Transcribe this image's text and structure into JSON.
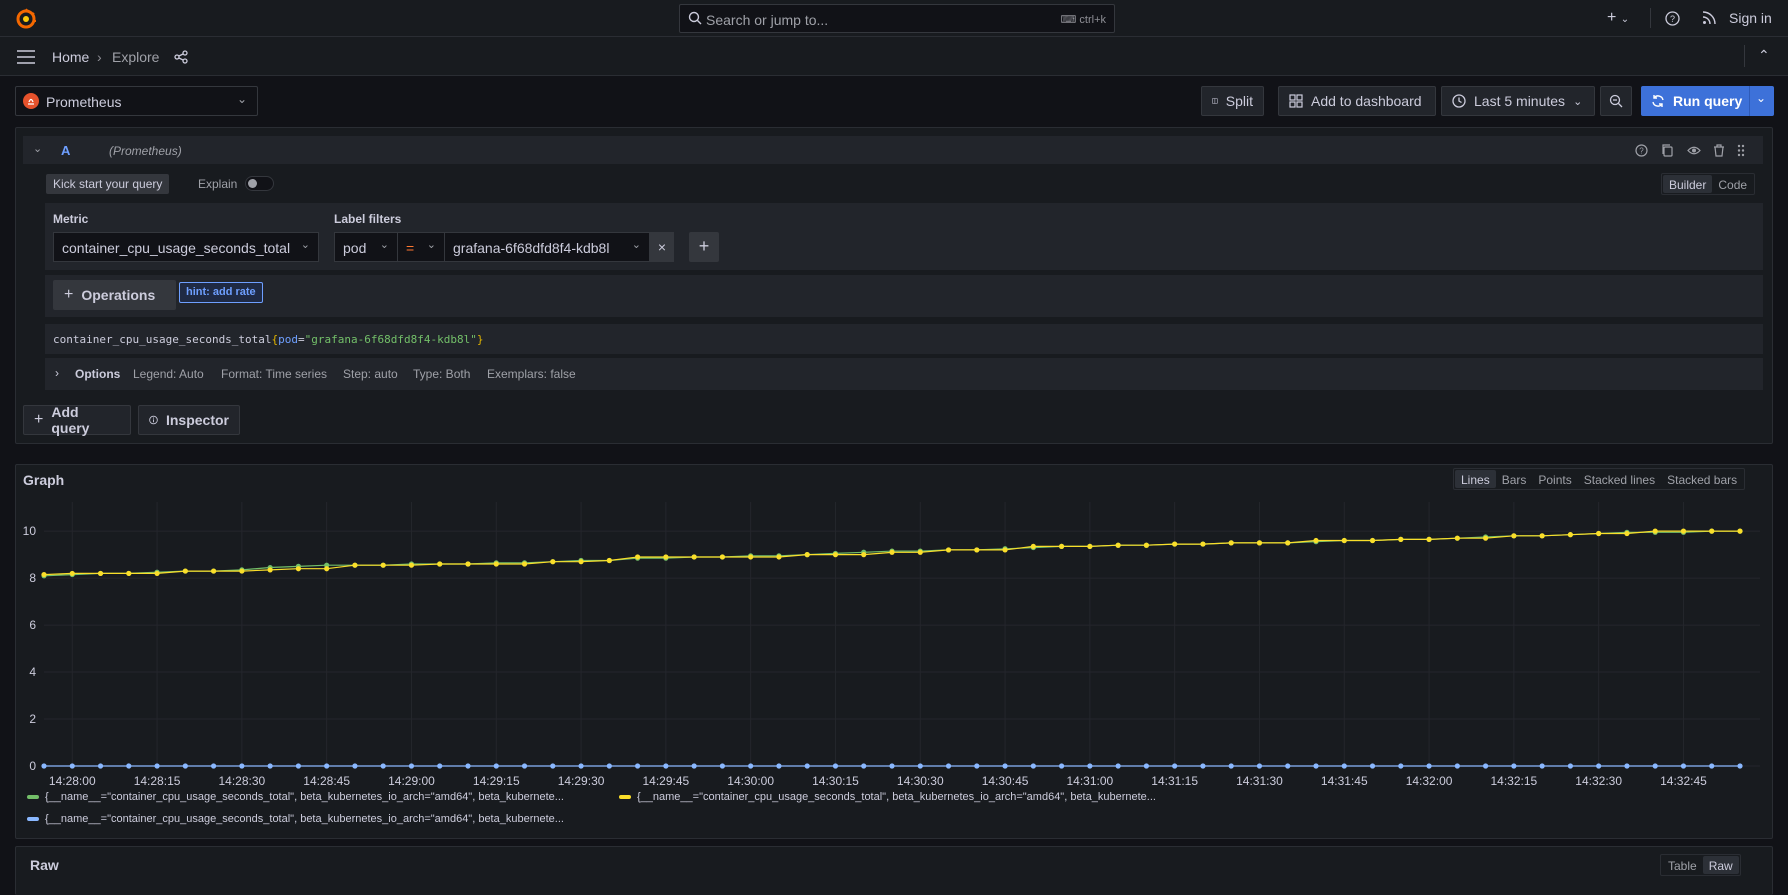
{
  "topbar": {
    "search_placeholder": "Search or jump to...",
    "search_shortcut": "ctrl+k",
    "sign_in": "Sign in"
  },
  "breadcrumb": {
    "home": "Home",
    "current": "Explore"
  },
  "toolbar": {
    "datasource": "Prometheus",
    "split": "Split",
    "add_to_dashboard": "Add to dashboard",
    "time_range": "Last 5 minutes",
    "run_query": "Run query"
  },
  "query": {
    "ref_id": "A",
    "datasource_label": "(Prometheus)",
    "kick_start": "Kick start your query",
    "explain": "Explain",
    "mode_builder": "Builder",
    "mode_code": "Code",
    "metric_label": "Metric",
    "metric_value": "container_cpu_usage_seconds_total",
    "label_filters_label": "Label filters",
    "label_key": "pod",
    "label_op": "=",
    "label_value": "grafana-6f68dfd8f4-kdb8l",
    "operations": "Operations",
    "hint": "hint: add rate",
    "preview_metric": "container_cpu_usage_seconds_total",
    "preview_open": "{",
    "preview_key": "pod",
    "preview_eq": "=",
    "preview_val": "\"grafana-6f68dfd8f4-kdb8l\"",
    "preview_close": "}",
    "options_title": "Options",
    "options_legend": "Legend: Auto",
    "options_format": "Format: Time series",
    "options_step": "Step: auto",
    "options_type": "Type: Both",
    "options_exemplars": "Exemplars: false"
  },
  "actions": {
    "add_query": "Add query",
    "inspector": "Inspector"
  },
  "graph": {
    "title": "Graph",
    "modes": [
      "Lines",
      "Bars",
      "Points",
      "Stacked lines",
      "Stacked bars"
    ],
    "active_mode": "Lines",
    "legend": [
      {
        "text": "{__name__=\"container_cpu_usage_seconds_total\", beta_kubernetes_io_arch=\"amd64\", beta_kubernete...",
        "color": "#73bf69"
      },
      {
        "text": "{__name__=\"container_cpu_usage_seconds_total\", beta_kubernetes_io_arch=\"amd64\", beta_kubernete...",
        "color": "#fade2a"
      },
      {
        "text": "{__name__=\"container_cpu_usage_seconds_total\", beta_kubernetes_io_arch=\"amd64\", beta_kubernete...",
        "color": "#8ab8ff"
      }
    ]
  },
  "raw": {
    "title": "Raw",
    "modes": [
      "Table",
      "Raw"
    ],
    "active_mode": "Raw"
  },
  "chart_data": {
    "type": "line",
    "x_ticks": [
      "14:28:00",
      "14:28:15",
      "14:28:30",
      "14:28:45",
      "14:29:00",
      "14:29:15",
      "14:29:30",
      "14:29:45",
      "14:30:00",
      "14:30:15",
      "14:30:30",
      "14:30:45",
      "14:31:00",
      "14:31:15",
      "14:31:30",
      "14:31:45",
      "14:32:00",
      "14:32:15",
      "14:32:30",
      "14:32:45"
    ],
    "y_ticks": [
      0,
      2,
      4,
      6,
      8,
      10
    ],
    "ylim": [
      0,
      10.9
    ],
    "x_start": "14:27:55",
    "x_step_seconds": 5,
    "grid": true,
    "legend_position": "bottom",
    "series": [
      {
        "color": "#73bf69",
        "values": [
          8.1,
          8.15,
          8.2,
          8.2,
          8.25,
          8.3,
          8.3,
          8.35,
          8.45,
          8.5,
          8.55,
          8.55,
          8.55,
          8.6,
          8.6,
          8.6,
          8.65,
          8.65,
          8.7,
          8.75,
          8.75,
          8.85,
          8.85,
          8.9,
          8.9,
          8.95,
          8.95,
          9.0,
          9.05,
          9.1,
          9.15,
          9.15,
          9.2,
          9.2,
          9.25,
          9.3,
          9.35,
          9.35,
          9.4,
          9.4,
          9.45,
          9.45,
          9.5,
          9.5,
          9.5,
          9.55,
          9.6,
          9.6,
          9.65,
          9.65,
          9.7,
          9.75,
          9.8,
          9.8,
          9.85,
          9.9,
          9.95,
          9.95,
          9.95,
          10.0,
          10.0
        ]
      },
      {
        "color": "#fade2a",
        "values": [
          8.15,
          8.2,
          8.2,
          8.2,
          8.2,
          8.3,
          8.3,
          8.3,
          8.35,
          8.4,
          8.4,
          8.55,
          8.55,
          8.55,
          8.6,
          8.6,
          8.6,
          8.6,
          8.7,
          8.7,
          8.75,
          8.9,
          8.9,
          8.9,
          8.9,
          8.9,
          8.9,
          9.0,
          9.0,
          9.0,
          9.1,
          9.1,
          9.2,
          9.2,
          9.2,
          9.35,
          9.35,
          9.35,
          9.4,
          9.4,
          9.45,
          9.45,
          9.5,
          9.5,
          9.5,
          9.6,
          9.6,
          9.6,
          9.65,
          9.65,
          9.7,
          9.7,
          9.8,
          9.8,
          9.85,
          9.9,
          9.9,
          10.0,
          10.0,
          10.0,
          10.0
        ]
      },
      {
        "color": "#8ab8ff",
        "values": [
          0,
          0,
          0,
          0,
          0,
          0,
          0,
          0,
          0,
          0,
          0,
          0,
          0,
          0,
          0,
          0,
          0,
          0,
          0,
          0,
          0,
          0,
          0,
          0,
          0,
          0,
          0,
          0,
          0,
          0,
          0,
          0,
          0,
          0,
          0,
          0,
          0,
          0,
          0,
          0,
          0,
          0,
          0,
          0,
          0,
          0,
          0,
          0,
          0,
          0,
          0,
          0,
          0,
          0,
          0,
          0,
          0,
          0,
          0,
          0,
          0
        ]
      }
    ]
  }
}
